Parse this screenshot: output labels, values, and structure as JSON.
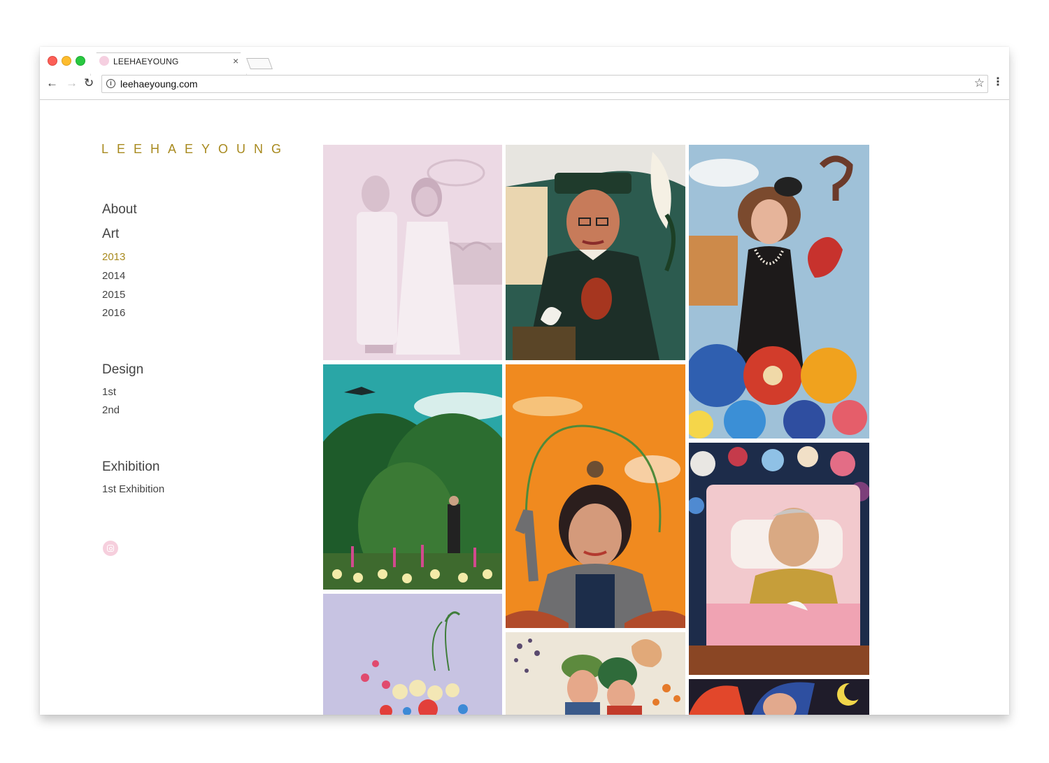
{
  "browser": {
    "tab_title": "LEEHAEYOUNG",
    "tab_close": "×",
    "url": "leehaeyoung.com",
    "icons": [
      "back-arrow-icon",
      "forward-arrow-icon",
      "reload-icon",
      "info-icon",
      "star-icon",
      "menu-icon",
      "close-icon"
    ]
  },
  "site": {
    "logo": "LEEHAEYOUNG",
    "accent_color": "#a88a1f",
    "nav": {
      "about": "About",
      "art": "Art",
      "art_years": [
        "2013",
        "2014",
        "2015",
        "2016"
      ],
      "active_year": "2013",
      "design": "Design",
      "design_items": [
        "1st",
        "2nd"
      ],
      "exhibition": "Exhibition",
      "exhibition_items": [
        "1st Exhibition"
      ]
    },
    "social_icon": "instagram-icon"
  },
  "gallery": {
    "columns": 3,
    "artworks": [
      {
        "name": "wedding-couple-painting",
        "highlighted": true
      },
      {
        "name": "man-with-calla-lily-painting",
        "highlighted": false
      },
      {
        "name": "woman-with-flowers-painting",
        "highlighted": false
      },
      {
        "name": "green-hills-kite-painting",
        "highlighted": false
      },
      {
        "name": "woman-with-owl-orange-painting",
        "highlighted": false
      },
      {
        "name": "elder-in-bed-painting",
        "highlighted": false
      },
      {
        "name": "flower-bouquet-painting",
        "highlighted": false
      },
      {
        "name": "two-figures-painting",
        "highlighted": false
      },
      {
        "name": "blue-hair-moon-painting",
        "highlighted": false
      }
    ]
  }
}
